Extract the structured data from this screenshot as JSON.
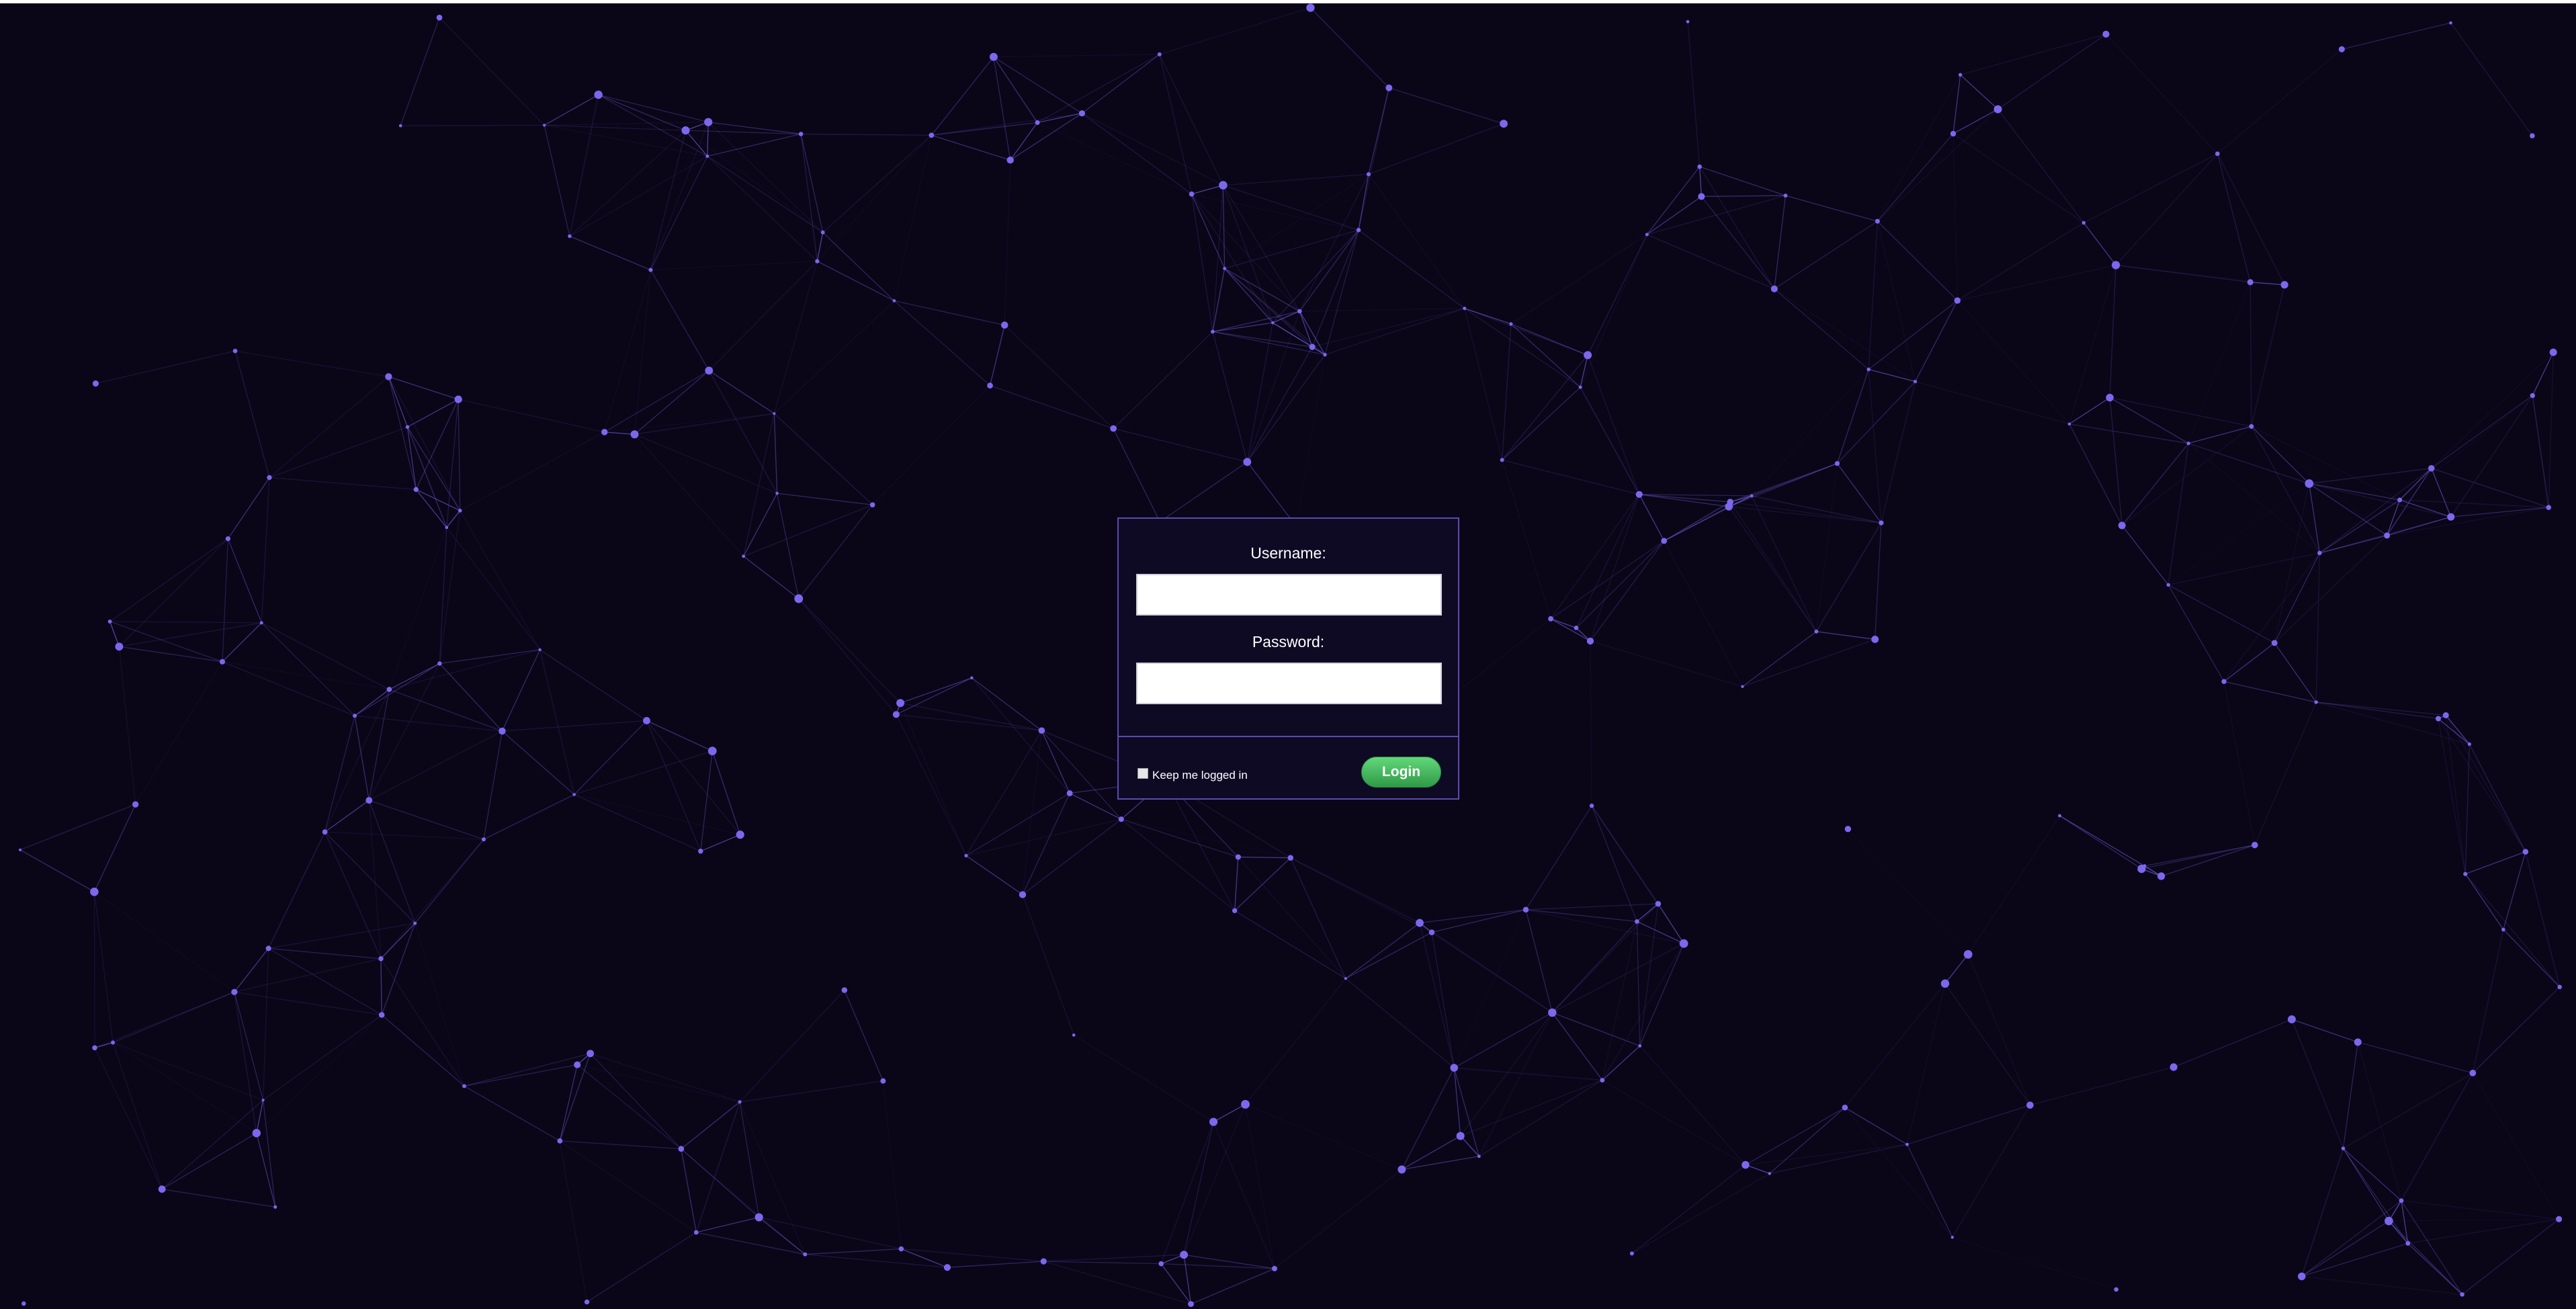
{
  "background": {
    "color": "#0a0618",
    "node_color": "#7b68ee",
    "line_color": "#6a5acd"
  },
  "login": {
    "username_label": "Username:",
    "username_value": "",
    "password_label": "Password:",
    "password_value": "",
    "keep_logged_in_label": "Keep me logged in",
    "keep_logged_in_checked": false,
    "login_button_label": "Login",
    "accent_color": "#5a4bb0",
    "button_color": "#3fb55a"
  }
}
